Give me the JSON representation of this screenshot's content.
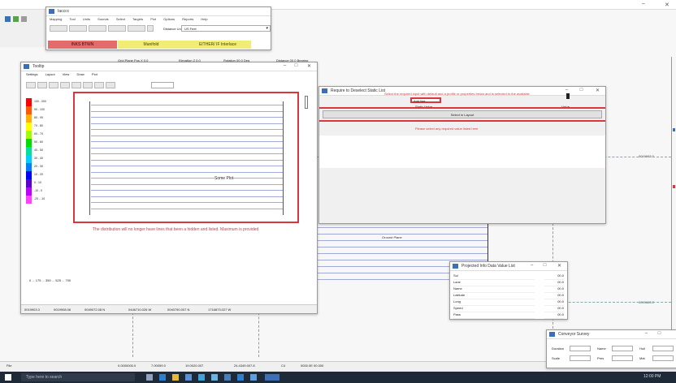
{
  "main_title": "Iacccc",
  "ribbon": {
    "menu": [
      "Mapping",
      "Tool",
      "Units",
      "Sounds",
      "Select",
      "Targets",
      "Plot",
      "Options",
      "Reports",
      "Help"
    ],
    "toolbar_label": "Distance Unit",
    "toolbar_value": "US Feet",
    "status_red": "INKS BTWN",
    "status_yellow": "Manifold",
    "status_yellow2": "EITHER/ IF Interlace"
  },
  "coordinates": {
    "x": "Grid Plane Pos X 0,0",
    "z": "Elevation Z 0,0",
    "w": "Rotation 00.0 Deg",
    "d": "Distance 00.0 Bearing"
  },
  "left_window": {
    "title": "Tooltip",
    "menu": [
      "Settings",
      "Layout",
      "View",
      "Draw",
      "Plot"
    ],
    "legend_values": [
      "100 - 000",
      "90 - 100",
      "80 - 90",
      "70 - 80",
      "60 - 70",
      "50 - 60",
      "40 - 50",
      "30 - 40",
      "20 - 30",
      "10 - 20",
      "0 - 10",
      "-10 - 0",
      "-20 - -10"
    ],
    "legend_colors": [
      "#ff0000",
      "#ff5a00",
      "#ffb000",
      "#ffff00",
      "#a0ff00",
      "#00e000",
      "#00e0a0",
      "#00d0ff",
      "#0080ff",
      "#0000ff",
      "#6000d0",
      "#c000ff",
      "#ff40ff"
    ],
    "scale": "0 ... 175 ... 350 ... 525 ... 700",
    "plot_label": "Some Plot",
    "caption": "The distribution will no longer have lines that been a hidden and listed. Maximum is provided",
    "status": [
      "0019903.3",
      "0019908.06",
      "0049072.08 N",
      "0446710.026 W",
      "0040790.007 N",
      "1716873.027 W"
    ]
  },
  "center_window": {
    "title": "Require to Deselect Static List",
    "instruction": "Select the required input with default and a profile or properties below and is selected to the available",
    "input_value": "Add line",
    "col_header": "Static Value",
    "col_header2": "Value",
    "select_button": "Select in Layout",
    "hint": "Please select any required value listed here"
  },
  "small_table": {
    "title": "Projected Info Data Value List",
    "rows": [
      [
        "Sol",
        "00.0"
      ],
      [
        "Lane",
        "00.0"
      ],
      [
        "Name",
        "00.0"
      ],
      [
        "Latitude",
        "00.0"
      ],
      [
        "Long",
        "00.0"
      ],
      [
        "Speed",
        "00.0"
      ],
      [
        "Pass",
        "00.0"
      ]
    ]
  },
  "bottom_window": {
    "title": "Conveyor Survey",
    "fields": [
      [
        "Duration",
        "Name",
        "Hull"
      ],
      [
        "Scale",
        "Pres",
        "Mat"
      ]
    ]
  },
  "main_plot": {
    "label": "Ground Plane",
    "right_label": "0019663.0",
    "right_label2": "0019663.0"
  },
  "status_bar": {
    "left": "File",
    "items": [
      "0.0000000.0",
      "7.00059.0",
      "19.0020.007",
      "24.4349.007.8",
      "C4",
      "0000.0E 00.000"
    ]
  },
  "taskbar": {
    "search": "Type here to search",
    "time": "12:00 PM"
  }
}
